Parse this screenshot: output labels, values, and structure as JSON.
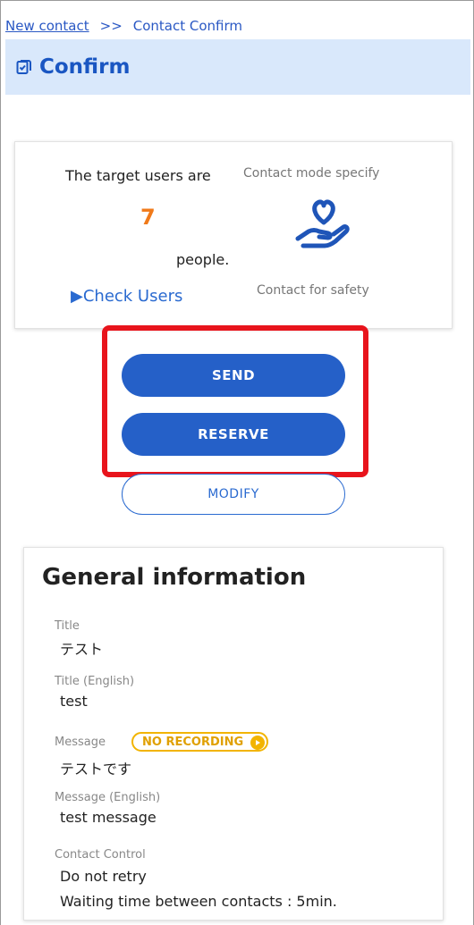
{
  "breadcrumb": {
    "link": "New contact",
    "separator": ">>",
    "current": "Contact Confirm"
  },
  "header": {
    "title": "Confirm",
    "icon": "checklist-icon",
    "background": "#d9e8fb"
  },
  "target": {
    "users_text": "The target users are",
    "count": "7",
    "people_text": "people.",
    "check_users": "▶Check Users",
    "mode_label": "Contact mode specify",
    "mode_icon": "heart-hand-icon",
    "mode_value": "Contact for safety"
  },
  "actions": {
    "send": "SEND",
    "reserve": "RESERVE",
    "modify": "MODIFY"
  },
  "general": {
    "heading": "General information",
    "fields": [
      {
        "label": "Title",
        "value": "テスト"
      },
      {
        "label": "Title (English)",
        "value": "test"
      },
      {
        "label": "Message",
        "value": "テストです"
      },
      {
        "label": "Message (English)",
        "value": "test message"
      },
      {
        "label": "Contact Control",
        "value": "Do not retry"
      }
    ],
    "waiting_time": "Waiting time between contacts : 5min.",
    "badge": "NO RECORDING"
  },
  "colors": {
    "accent": "#2560c8",
    "highlight": "#e8141c",
    "count": "#f07a1a",
    "badge": "#f2b400"
  }
}
